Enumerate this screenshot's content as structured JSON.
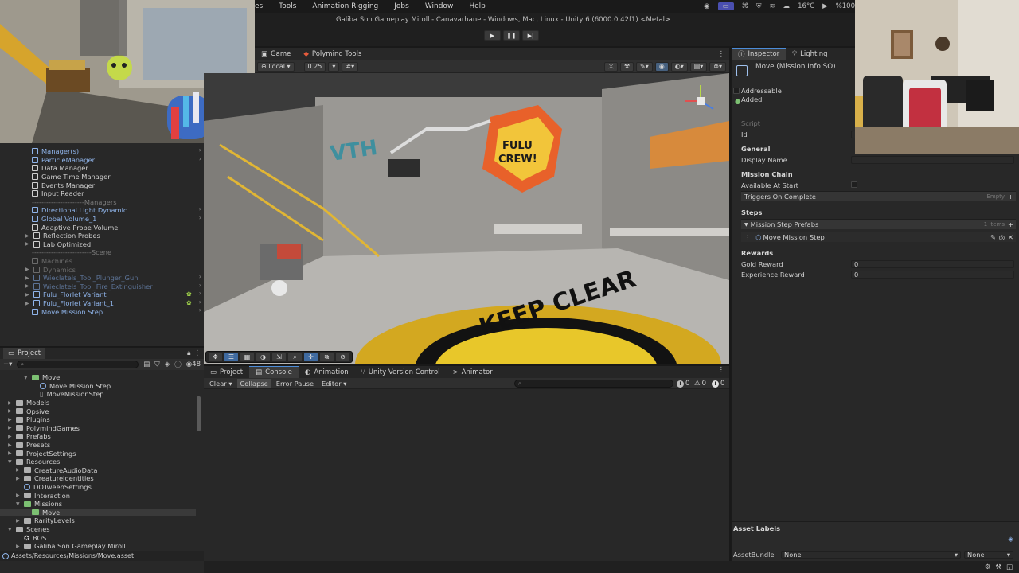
{
  "menubar": {
    "items": [
      "es",
      "Tools",
      "Animation Rigging",
      "Jobs",
      "Window",
      "Help"
    ],
    "temperature": "16°C",
    "battery": "%100"
  },
  "window": {
    "title": "Galiba Son Gameplay Miroll - Canavarhane - Windows, Mac, Linux - Unity 6 (6000.0.42f1) <Metal>"
  },
  "scene": {
    "tabs": [
      {
        "label": "Game"
      },
      {
        "label": "Polymind Tools"
      }
    ],
    "pivot_mode": "Local",
    "grid_value": "0.25"
  },
  "hierarchy": {
    "items": [
      {
        "label": "Manager(s)",
        "type": "prefab",
        "expand": false
      },
      {
        "label": "ParticleManager",
        "type": "prefab",
        "expand": false
      },
      {
        "label": "Data Manager",
        "type": "object",
        "expand": false
      },
      {
        "label": "Game Time Manager",
        "type": "object",
        "expand": false
      },
      {
        "label": "Events Manager",
        "type": "object",
        "expand": false
      },
      {
        "label": "Input Reader",
        "type": "object",
        "expand": false
      },
      {
        "label": "----------------------Managers",
        "type": "sep",
        "expand": false
      },
      {
        "label": "Directional Light Dynamic",
        "type": "prefab",
        "expand": false
      },
      {
        "label": "Global Volume_1",
        "type": "prefab",
        "expand": false
      },
      {
        "label": "Adaptive Probe Volume",
        "type": "object",
        "expand": false
      },
      {
        "label": "Reflection Probes",
        "type": "object",
        "expand": true
      },
      {
        "label": "Lab Optimized",
        "type": "object",
        "expand": true
      },
      {
        "label": "-------------------------Scene",
        "type": "sep",
        "expand": false
      },
      {
        "label": "Machines",
        "type": "dim",
        "expand": false
      },
      {
        "label": "Dynamics",
        "type": "dim",
        "expand": true
      },
      {
        "label": "Wieclatels_Tool_Plunger_Gun",
        "type": "dimprefab",
        "expand": true
      },
      {
        "label": "Wieclatels_Tool_Fire_Extinguisher",
        "type": "dimprefab",
        "expand": true
      },
      {
        "label": "Fulu_Florlet Variant",
        "type": "prefab",
        "expand": true
      },
      {
        "label": "Fulu_Florlet Variant_1",
        "type": "prefab",
        "expand": true
      },
      {
        "label": "Move Mission Step",
        "type": "prefab",
        "expand": false
      }
    ]
  },
  "project": {
    "tab_label": "Project",
    "visible_count": "48",
    "tree": [
      {
        "label": "Move",
        "indent": 3,
        "kind": "folder-green",
        "expand": true
      },
      {
        "label": "Move Mission Step",
        "indent": 4,
        "kind": "so"
      },
      {
        "label": "MoveMissionStep",
        "indent": 4,
        "kind": "file"
      },
      {
        "label": "Models",
        "indent": 1,
        "kind": "folder",
        "expand": false
      },
      {
        "label": "Opsive",
        "indent": 1,
        "kind": "folder",
        "expand": false
      },
      {
        "label": "Plugins",
        "indent": 1,
        "kind": "folder",
        "expand": false
      },
      {
        "label": "PolymindGames",
        "indent": 1,
        "kind": "folder",
        "expand": false
      },
      {
        "label": "Prefabs",
        "indent": 1,
        "kind": "folder",
        "expand": false
      },
      {
        "label": "Presets",
        "indent": 1,
        "kind": "folder",
        "expand": false
      },
      {
        "label": "ProjectSettings",
        "indent": 1,
        "kind": "folder",
        "expand": false
      },
      {
        "label": "Resources",
        "indent": 1,
        "kind": "folder",
        "expand": true
      },
      {
        "label": "CreatureAudioData",
        "indent": 2,
        "kind": "folder",
        "expand": false
      },
      {
        "label": "CreatureIdentities",
        "indent": 2,
        "kind": "folder",
        "expand": false
      },
      {
        "label": "DOTweenSettings",
        "indent": 2,
        "kind": "so"
      },
      {
        "label": "Interaction",
        "indent": 2,
        "kind": "folder",
        "expand": false
      },
      {
        "label": "Missions",
        "indent": 2,
        "kind": "folder-green",
        "expand": true
      },
      {
        "label": "Move",
        "indent": 3,
        "kind": "folder-green",
        "selected": true
      },
      {
        "label": "RarityLevels",
        "indent": 2,
        "kind": "folder",
        "expand": false
      },
      {
        "label": "Scenes",
        "indent": 1,
        "kind": "folder",
        "expand": true
      },
      {
        "label": "BOS",
        "indent": 2,
        "kind": "unity"
      },
      {
        "label": "Galiba Son Gameplay Miroll",
        "indent": 2,
        "kind": "folder",
        "expand": false
      }
    ],
    "path": "Assets/Resources/Missions/Move.asset"
  },
  "console": {
    "tabs": [
      {
        "label": "Project"
      },
      {
        "label": "Console"
      },
      {
        "label": "Animation"
      },
      {
        "label": "Unity Version Control"
      },
      {
        "label": "Animator"
      }
    ],
    "toolbar": {
      "clear": "Clear",
      "collapse": "Collapse",
      "error_pause": "Error Pause",
      "editor": "Editor"
    },
    "counts": {
      "logs": "0",
      "warnings": "0",
      "errors": "0"
    }
  },
  "inspector": {
    "tabs": [
      {
        "label": "Inspector"
      },
      {
        "label": "Lighting"
      }
    ],
    "object_title": "Move (Mission Info SO)",
    "addressable_label": "Addressable",
    "added_label": "Added",
    "script_label": "Script",
    "id_label": "Id",
    "general_header": "General",
    "display_name_label": "Display Name",
    "mission_chain_header": "Mission Chain",
    "available_at_start_label": "Available At Start",
    "triggers_label": "Triggers On Complete",
    "triggers_empty": "Empty",
    "steps_header": "Steps",
    "step_prefabs_label": "Mission Step Prefabs",
    "step_prefabs_count": "1 Items",
    "step_item": "Move Mission Step",
    "rewards_header": "Rewards",
    "gold_label": "Gold Reward",
    "gold_value": "0",
    "xp_label": "Experience Reward",
    "xp_value": "0",
    "asset_labels": "Asset Labels",
    "assetbundle_label": "AssetBundle",
    "assetbundle_value": "None",
    "variant_value": "None"
  }
}
